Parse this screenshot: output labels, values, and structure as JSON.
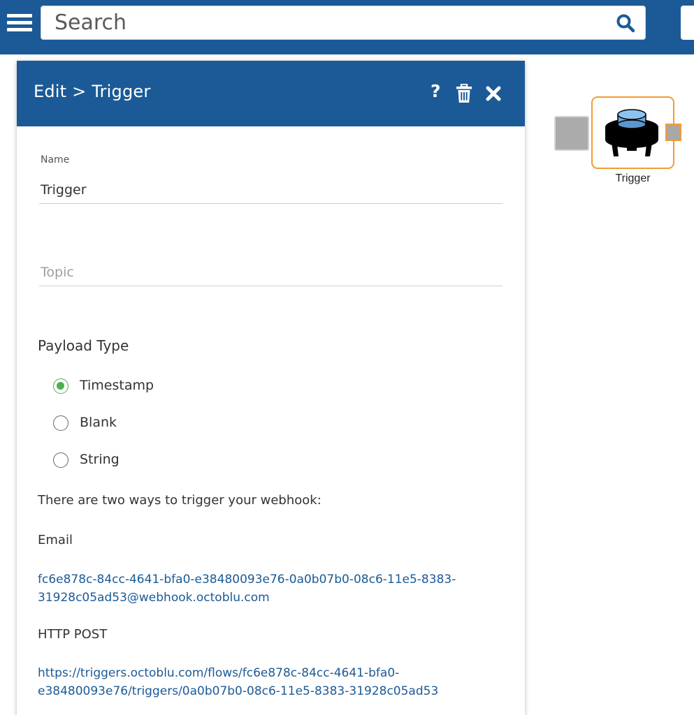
{
  "topbar": {
    "search": {
      "placeholder": "Search"
    }
  },
  "panel": {
    "title": "Edit > Trigger",
    "help_label": "?",
    "name_label": "Name",
    "name_value": "Trigger",
    "topic_placeholder": "Topic",
    "payload_title": "Payload Type",
    "payload_options": [
      {
        "label": "Timestamp",
        "selected": true
      },
      {
        "label": "Blank",
        "selected": false
      },
      {
        "label": "String",
        "selected": false
      }
    ],
    "intro": "There are two ways to trigger your webhook:",
    "email_label": "Email",
    "email_address": "fc6e878c-84cc-4641-bfa0-e38480093e76-0a0b07b0-08c6-11e5-8383-31928c05ad53@webhook.octoblu.com",
    "post_label": "HTTP POST",
    "post_url": "https://triggers.octoblu.com/flows/fc6e878c-84cc-4641-bfa0-e38480093e76/triggers/0a0b07b0-08c6-11e5-8383-31928c05ad53"
  },
  "canvas": {
    "node_label": "Trigger",
    "node_icon": "trigger-button-icon"
  },
  "colors": {
    "brand_blue": "#1b5a96",
    "radio_green": "#4caf50",
    "node_border_orange": "#f39a36",
    "port_gray": "#ababab"
  }
}
